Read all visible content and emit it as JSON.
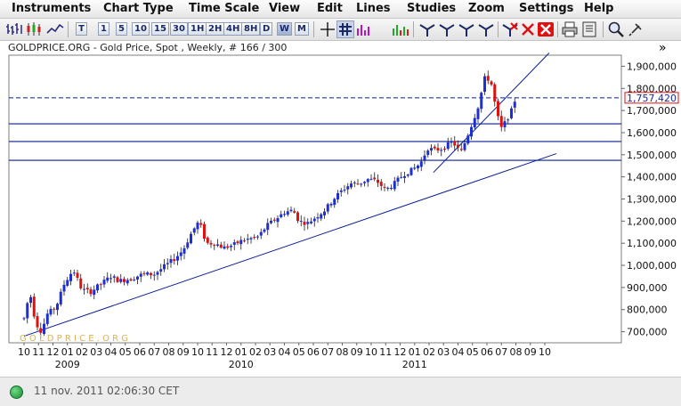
{
  "menu": {
    "items": [
      {
        "label": "Instruments"
      },
      {
        "label": "Chart Type"
      },
      {
        "label": "Time Scale"
      },
      {
        "label": "View"
      },
      {
        "label": "Edit"
      },
      {
        "label": "Lines"
      },
      {
        "label": "Studies"
      },
      {
        "label": "Zoom"
      },
      {
        "label": "Settings"
      },
      {
        "label": "Help"
      }
    ]
  },
  "toolbar": {
    "timeframes": [
      {
        "label": "T"
      },
      {
        "label": "1"
      },
      {
        "label": "5"
      },
      {
        "label": "10"
      },
      {
        "label": "15"
      },
      {
        "label": "30"
      },
      {
        "label": "1H"
      },
      {
        "label": "2H"
      },
      {
        "label": "4H"
      },
      {
        "label": "8H"
      },
      {
        "label": "D"
      },
      {
        "label": "W"
      },
      {
        "label": "M"
      }
    ],
    "icons": [
      "bar-chart-icon",
      "candlestick-icon",
      "line-chart-icon",
      "crosshair-icon",
      "grid-icon",
      "volume-icon",
      "trendline-icon",
      "delete-icon",
      "print-icon",
      "zoom-icon"
    ],
    "overflow_label": "»"
  },
  "chart": {
    "title": "GOLDPRICE.ORG - Gold Price, Spot , Weekly, # 166 / 300",
    "watermark": "G O L D P R I C E . O R G",
    "current_price_label": "1,757,420",
    "colors": {
      "up": "#1c2fd6",
      "down": "#e01010",
      "lines": "#0a1e96",
      "price_label": "#d11"
    }
  },
  "chart_data": {
    "type": "candlestick",
    "ylim": [
      650000,
      1950000
    ],
    "y_ticks": [
      {
        "value": 700000,
        "label": "700,000"
      },
      {
        "value": 800000,
        "label": "800,000"
      },
      {
        "value": 900000,
        "label": "900,000"
      },
      {
        "value": 1000000,
        "label": "1,000,000"
      },
      {
        "value": 1100000,
        "label": "1,100,000"
      },
      {
        "value": 1200000,
        "label": "1,200,000"
      },
      {
        "value": 1300000,
        "label": "1,300,000"
      },
      {
        "value": 1400000,
        "label": "1,400,000"
      },
      {
        "value": 1500000,
        "label": "1,500,000"
      },
      {
        "value": 1600000,
        "label": "1,600,000"
      },
      {
        "value": 1700000,
        "label": "1,700,000"
      },
      {
        "value": 1800000,
        "label": "1,800,000"
      },
      {
        "value": 1900000,
        "label": "1,900,000"
      }
    ],
    "month_labels": [
      "10",
      "11",
      "12",
      "01",
      "02",
      "03",
      "04",
      "05",
      "06",
      "07",
      "08",
      "09",
      "10",
      "11",
      "12",
      "01",
      "02",
      "03",
      "04",
      "05",
      "06",
      "07",
      "08",
      "09",
      "10",
      "11",
      "12",
      "01",
      "02",
      "03",
      "04",
      "05",
      "06",
      "07",
      "08",
      "09",
      "10"
    ],
    "year_labels": [
      {
        "label": "2009",
        "month_index": 3
      },
      {
        "label": "2010",
        "month_index": 15
      },
      {
        "label": "2011",
        "month_index": 27
      }
    ],
    "current_price": 1757420,
    "horizontal_lines": [
      1640000,
      1560000,
      1475000
    ],
    "trendlines": [
      {
        "from": [
          0,
          680000
        ],
        "to": [
          36.8,
          1505000
        ]
      },
      {
        "from": [
          28.3,
          1420000
        ],
        "to": [
          36.3,
          1960000
        ]
      }
    ],
    "anchors": [
      [
        0.0,
        760000
      ],
      [
        0.4,
        880000
      ],
      [
        0.8,
        740000
      ],
      [
        1.2,
        700000
      ],
      [
        1.6,
        780000
      ],
      [
        2.2,
        810000
      ],
      [
        2.8,
        920000
      ],
      [
        3.4,
        980000
      ],
      [
        4.0,
        890000
      ],
      [
        4.6,
        880000
      ],
      [
        5.4,
        920000
      ],
      [
        6.0,
        950000
      ],
      [
        6.6,
        930000
      ],
      [
        7.4,
        940000
      ],
      [
        8.2,
        960000
      ],
      [
        9.0,
        960000
      ],
      [
        9.6,
        990000
      ],
      [
        10.4,
        1030000
      ],
      [
        11.0,
        1070000
      ],
      [
        11.6,
        1150000
      ],
      [
        12.1,
        1200000
      ],
      [
        12.6,
        1100000
      ],
      [
        13.2,
        1100000
      ],
      [
        13.8,
        1080000
      ],
      [
        14.4,
        1090000
      ],
      [
        15.0,
        1110000
      ],
      [
        15.6,
        1120000
      ],
      [
        16.2,
        1130000
      ],
      [
        16.8,
        1180000
      ],
      [
        17.4,
        1210000
      ],
      [
        18.0,
        1240000
      ],
      [
        18.6,
        1250000
      ],
      [
        19.0,
        1200000
      ],
      [
        19.6,
        1190000
      ],
      [
        20.2,
        1220000
      ],
      [
        20.8,
        1250000
      ],
      [
        21.4,
        1300000
      ],
      [
        22.0,
        1340000
      ],
      [
        22.6,
        1370000
      ],
      [
        23.2,
        1370000
      ],
      [
        23.8,
        1390000
      ],
      [
        24.4,
        1380000
      ],
      [
        25.0,
        1340000
      ],
      [
        25.6,
        1370000
      ],
      [
        26.2,
        1410000
      ],
      [
        26.8,
        1430000
      ],
      [
        27.4,
        1460000
      ],
      [
        27.9,
        1530000
      ],
      [
        28.4,
        1520000
      ],
      [
        29.0,
        1530000
      ],
      [
        29.6,
        1560000
      ],
      [
        30.2,
        1510000
      ],
      [
        30.8,
        1610000
      ],
      [
        31.4,
        1720000
      ],
      [
        31.9,
        1860000
      ],
      [
        32.3,
        1820000
      ],
      [
        32.7,
        1680000
      ],
      [
        33.0,
        1620000
      ],
      [
        33.3,
        1650000
      ],
      [
        33.7,
        1700000
      ],
      [
        34.0,
        1760000
      ]
    ]
  },
  "status": {
    "timestamp": "11 nov. 2011 02:06:30 CET"
  }
}
